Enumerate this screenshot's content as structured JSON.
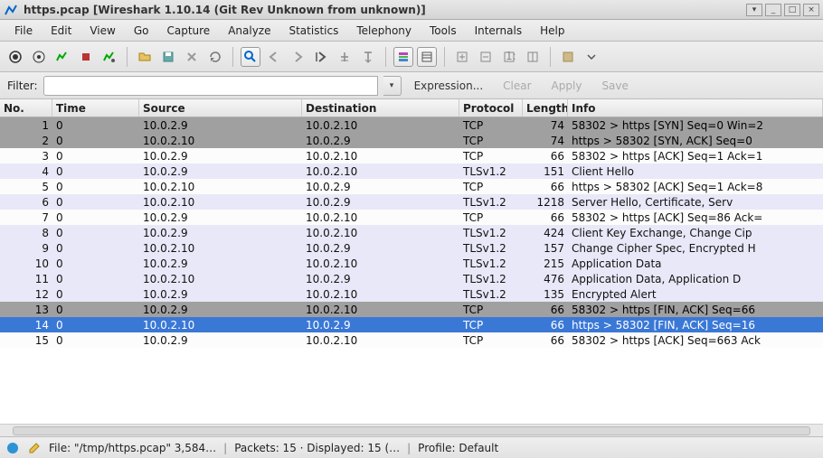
{
  "titlebar": {
    "text": "https.pcap     [Wireshark 1.10.14   (Git Rev Unknown from unknown)]"
  },
  "menu": [
    "File",
    "Edit",
    "View",
    "Go",
    "Capture",
    "Analyze",
    "Statistics",
    "Telephony",
    "Tools",
    "Internals",
    "Help"
  ],
  "filter": {
    "label": "Filter:",
    "value": "",
    "expression": "Expression...",
    "clear": "Clear",
    "apply": "Apply",
    "save": "Save"
  },
  "columns": [
    "No.",
    "Time",
    "Source",
    "Destination",
    "Protocol",
    "Length",
    "Info"
  ],
  "packets": [
    {
      "no": "1",
      "time": "0",
      "src": "10.0.2.9",
      "dst": "10.0.2.10",
      "proto": "TCP",
      "len": "74",
      "info": "58302 > https [SYN] Seq=0 Win=2",
      "style": "grey"
    },
    {
      "no": "2",
      "time": "0",
      "src": "10.0.2.10",
      "dst": "10.0.2.9",
      "proto": "TCP",
      "len": "74",
      "info": "https > 58302 [SYN, ACK] Seq=0",
      "style": "grey"
    },
    {
      "no": "3",
      "time": "0",
      "src": "10.0.2.9",
      "dst": "10.0.2.10",
      "proto": "TCP",
      "len": "66",
      "info": "58302 > https [ACK] Seq=1 Ack=1",
      "style": "light"
    },
    {
      "no": "4",
      "time": "0",
      "src": "10.0.2.9",
      "dst": "10.0.2.10",
      "proto": "TLSv1.2",
      "len": "151",
      "info": "Client Hello",
      "style": "blue"
    },
    {
      "no": "5",
      "time": "0",
      "src": "10.0.2.10",
      "dst": "10.0.2.9",
      "proto": "TCP",
      "len": "66",
      "info": "https > 58302 [ACK] Seq=1 Ack=8",
      "style": "light"
    },
    {
      "no": "6",
      "time": "0",
      "src": "10.0.2.10",
      "dst": "10.0.2.9",
      "proto": "TLSv1.2",
      "len": "1218",
      "info": "Server Hello, Certificate, Serv",
      "style": "blue"
    },
    {
      "no": "7",
      "time": "0",
      "src": "10.0.2.9",
      "dst": "10.0.2.10",
      "proto": "TCP",
      "len": "66",
      "info": "58302 > https [ACK] Seq=86 Ack=",
      "style": "light"
    },
    {
      "no": "8",
      "time": "0",
      "src": "10.0.2.9",
      "dst": "10.0.2.10",
      "proto": "TLSv1.2",
      "len": "424",
      "info": "Client Key Exchange, Change Cip",
      "style": "blue"
    },
    {
      "no": "9",
      "time": "0",
      "src": "10.0.2.10",
      "dst": "10.0.2.9",
      "proto": "TLSv1.2",
      "len": "157",
      "info": "Change Cipher Spec, Encrypted H",
      "style": "blue"
    },
    {
      "no": "10",
      "time": "0",
      "src": "10.0.2.9",
      "dst": "10.0.2.10",
      "proto": "TLSv1.2",
      "len": "215",
      "info": "Application Data",
      "style": "blue"
    },
    {
      "no": "11",
      "time": "0",
      "src": "10.0.2.10",
      "dst": "10.0.2.9",
      "proto": "TLSv1.2",
      "len": "476",
      "info": "Application Data, Application D",
      "style": "blue"
    },
    {
      "no": "12",
      "time": "0",
      "src": "10.0.2.9",
      "dst": "10.0.2.10",
      "proto": "TLSv1.2",
      "len": "135",
      "info": "Encrypted Alert",
      "style": "blue"
    },
    {
      "no": "13",
      "time": "0",
      "src": "10.0.2.9",
      "dst": "10.0.2.10",
      "proto": "TCP",
      "len": "66",
      "info": "58302 > https [FIN, ACK] Seq=66",
      "style": "grey"
    },
    {
      "no": "14",
      "time": "0",
      "src": "10.0.2.10",
      "dst": "10.0.2.9",
      "proto": "TCP",
      "len": "66",
      "info": "https > 58302 [FIN, ACK] Seq=16",
      "style": "sel"
    },
    {
      "no": "15",
      "time": "0",
      "src": "10.0.2.9",
      "dst": "10.0.2.10",
      "proto": "TCP",
      "len": "66",
      "info": "58302 > https [ACK] Seq=663 Ack",
      "style": "light"
    }
  ],
  "status": {
    "file": "File: \"/tmp/https.pcap\" 3,584…",
    "packets": "Packets: 15 · Displayed: 15 (…",
    "profile": "Profile: Default"
  },
  "icons": {
    "fin": "#009f00"
  }
}
